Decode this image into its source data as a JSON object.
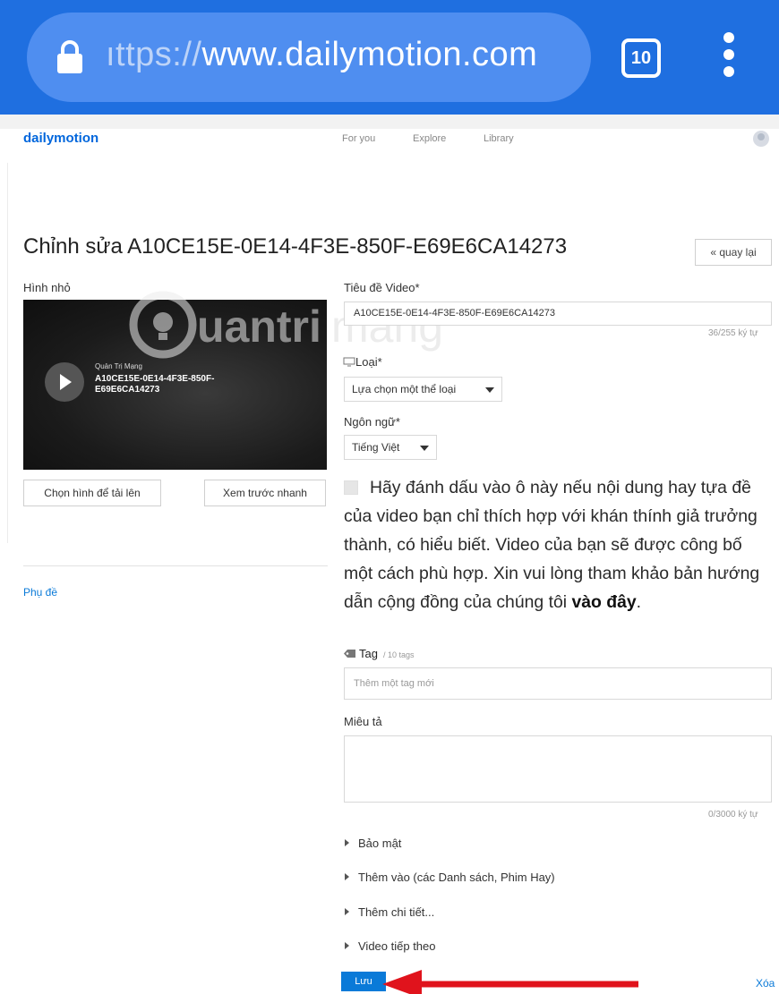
{
  "browser": {
    "url_hidden_prefix": "ıttps://",
    "url_domain": "www.dailymotion.com",
    "tab_count": "10",
    "icons": [
      "lock-icon",
      "tab-count-icon",
      "overflow-menu-icon"
    ]
  },
  "site": {
    "logo": "dailymotion",
    "nav": [
      "For you",
      "Explore",
      "Library"
    ],
    "brand_color": "#0066dc"
  },
  "page": {
    "title": "Chỉnh sửa A10CE15E-0E14-4F3E-850F-E69E6CA14273",
    "back_label": "« quay lại"
  },
  "thumbnail": {
    "label": "Hình nhỏ",
    "channel": "Quản Trị Mạng",
    "video_title": "A10CE15E-0E14-4F3E-850F-E69E6CA14273",
    "upload_label": "Chọn hình để tải lên",
    "preview_label": "Xem trước nhanh",
    "watermark": "Quantrimang"
  },
  "subtitles_link": "Phụ đề",
  "form": {
    "title_label": "Tiêu đề Video*",
    "title_value": "A10CE15E-0E14-4F3E-850F-E69E6CA14273",
    "title_counter": "36/255 ký tự",
    "category_label": "Loại*",
    "category_value": "Lựa chọn một thể loại",
    "language_label": "Ngôn ngữ*",
    "language_value": "Tiếng Việt",
    "mature_text": "Hãy đánh dấu vào ô này nếu nội dung hay tựa đề của video bạn chỉ thích hợp với khán thính giả trưởng thành, có hiểu biết. Video của bạn sẽ được công bố một cách phù hợp. Xin vui lòng tham khảo bản hướng dẫn cộng đồng của chúng tôi ",
    "mature_link": "vào đây",
    "mature_end": ".",
    "tag_label": "Tag",
    "tag_sub": "/ 10 tags",
    "tag_placeholder": "Thêm một tag mới",
    "description_label": "Miêu tả",
    "description_counter": "0/3000 ký tự"
  },
  "expanders": [
    "Bảo mật",
    "Thêm vào (các Danh sách, Phim Hay)",
    "Thêm chi tiết...",
    "Video tiếp theo"
  ],
  "actions": {
    "save_label": "Lưu",
    "delete_label": "Xóa"
  },
  "colors": {
    "browser_bar": "#1f6fe0",
    "link": "#0a7ad8",
    "annotation_arrow": "#e0131c"
  }
}
